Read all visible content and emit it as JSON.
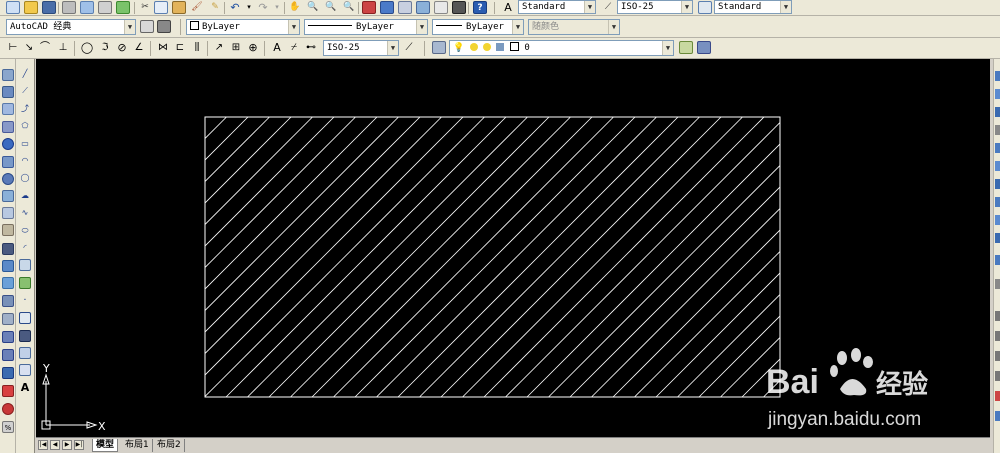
{
  "toolbar1": {
    "text_style": "Standard",
    "dim_style": "ISO-25",
    "table_style": "Standard"
  },
  "toolbar2": {
    "workspace": "AutoCAD 经典",
    "color": "ByLayer",
    "linetype": "ByLayer",
    "lineweight": "ByLayer",
    "plot_style": "随颜色"
  },
  "toolbar3": {
    "dim_style": "ISO-25",
    "layer": "0"
  },
  "ucs": {
    "x_label": "X",
    "y_label": "Y"
  },
  "tabs": {
    "model": "模型",
    "layout1": "布局1",
    "layout2": "布局2"
  },
  "watermark": {
    "brand": "Bai",
    "brand2": "经验",
    "url": "jingyan.baidu.com"
  },
  "colors": {
    "canvas": "#000000",
    "toolbar": "#ece9d8",
    "hatch": "#ffffff"
  }
}
